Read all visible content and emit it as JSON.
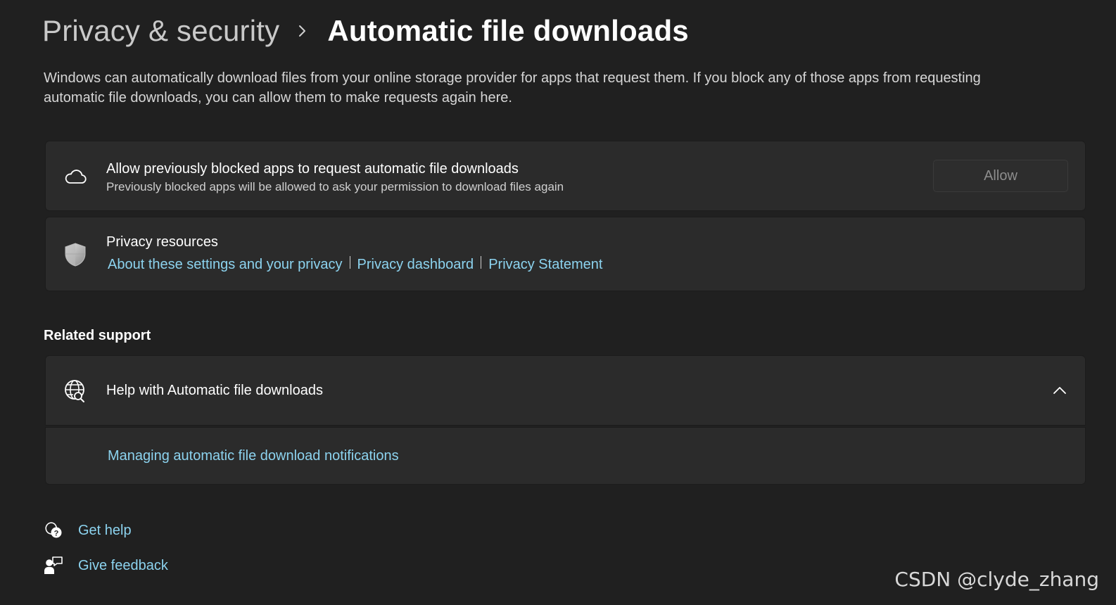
{
  "breadcrumb": {
    "parent": "Privacy & security",
    "separator_icon": "chevron-right-icon",
    "current": "Automatic file downloads"
  },
  "description": "Windows can automatically download files from your online storage provider for apps that request them. If you block any of those apps from requesting automatic file downloads, you can allow them to make requests again here.",
  "allow_card": {
    "icon": "cloud-icon",
    "title": "Allow previously blocked apps to request automatic file downloads",
    "subtitle": "Previously blocked apps will be allowed to ask your permission to download files again",
    "button_label": "Allow",
    "button_state": "disabled"
  },
  "privacy_card": {
    "icon": "shield-icon",
    "title": "Privacy resources",
    "links": [
      "About these settings and your privacy",
      "Privacy dashboard",
      "Privacy Statement"
    ]
  },
  "related_support": {
    "header": "Related support",
    "help_item": {
      "icon": "globe-search-icon",
      "title": "Help with Automatic file downloads",
      "expanded": true,
      "link": "Managing automatic file download notifications"
    }
  },
  "footer": {
    "get_help": {
      "icon": "help-chat-icon",
      "label": "Get help"
    },
    "give_feedback": {
      "icon": "feedback-icon",
      "label": "Give feedback"
    }
  },
  "watermark": "CSDN @clyde_zhang",
  "colors": {
    "background": "#202020",
    "card": "#2b2b2b",
    "link": "#8cd3ef",
    "text": "#ffffff",
    "secondary_text": "#cfcfcf"
  }
}
